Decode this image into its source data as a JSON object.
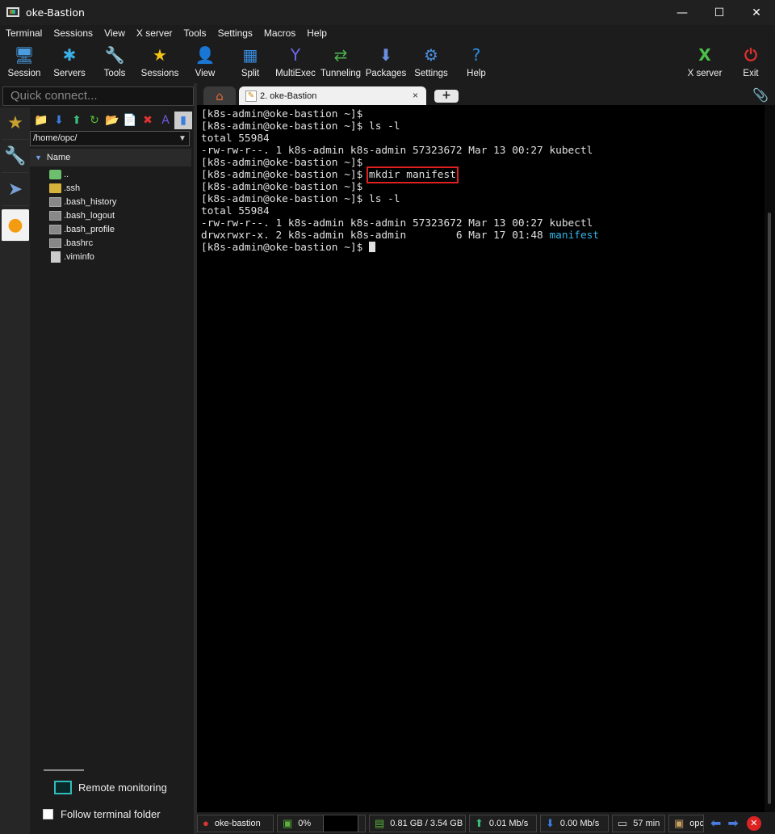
{
  "window": {
    "title": "oke-Bastion",
    "controls": {
      "minimize": "—",
      "maximize": "☐",
      "close": "✕"
    }
  },
  "menu": [
    "Terminal",
    "Sessions",
    "View",
    "X server",
    "Tools",
    "Settings",
    "Macros",
    "Help"
  ],
  "toolbar": {
    "buttons": [
      {
        "label": "Session",
        "icon": "session-icon",
        "glyph": "🖥",
        "color": "#4a9de0"
      },
      {
        "label": "Servers",
        "icon": "servers-icon",
        "glyph": "✱",
        "color": "#3ab0e8"
      },
      {
        "label": "Tools",
        "icon": "tools-icon",
        "glyph": "🔧",
        "color": "#d44"
      },
      {
        "label": "Sessions",
        "icon": "star-icon",
        "glyph": "★",
        "color": "#f2c318"
      },
      {
        "label": "View",
        "icon": "view-icon",
        "glyph": "👤",
        "color": "#5aa55a"
      },
      {
        "label": "Split",
        "icon": "split-icon",
        "glyph": "▦",
        "color": "#3a8de0"
      },
      {
        "label": "MultiExec",
        "icon": "multiexec-icon",
        "glyph": "Y",
        "color": "#6a6ae8"
      },
      {
        "label": "Tunneling",
        "icon": "tunneling-icon",
        "glyph": "⇄",
        "color": "#4ab04a"
      },
      {
        "label": "Packages",
        "icon": "packages-icon",
        "glyph": "⬇",
        "color": "#6a8ee0"
      },
      {
        "label": "Settings",
        "icon": "gear-icon",
        "glyph": "⚙",
        "color": "#4a8ee0"
      },
      {
        "label": "Help",
        "icon": "help-icon",
        "glyph": "?",
        "color": "#2a8ee8"
      }
    ],
    "right_buttons": [
      {
        "label": "X server",
        "icon": "x-server-icon",
        "glyph": "X",
        "color": "#4ac04a"
      },
      {
        "label": "Exit",
        "icon": "power-icon",
        "glyph": "⏻",
        "color": "#e03030"
      }
    ]
  },
  "quick_connect": {
    "placeholder": "Quick connect..."
  },
  "sftp": {
    "path": "/home/opc/",
    "column": "Name",
    "files": [
      {
        "name": "..",
        "type": "up"
      },
      {
        "name": ".ssh",
        "type": "folder"
      },
      {
        "name": ".bash_history",
        "type": "file"
      },
      {
        "name": ".bash_logout",
        "type": "file"
      },
      {
        "name": ".bash_profile",
        "type": "file"
      },
      {
        "name": ".bashrc",
        "type": "file"
      },
      {
        "name": ".viminfo",
        "type": "doc"
      }
    ],
    "remote_monitoring": "Remote monitoring",
    "follow_terminal_folder": "Follow terminal folder"
  },
  "tabs": {
    "active_tab": "2. oke-Bastion",
    "close": "×",
    "new": "+"
  },
  "terminal": {
    "lines": [
      {
        "text": "[k8s-admin@oke-bastion ~]$"
      },
      {
        "text": "[k8s-admin@oke-bastion ~]$ ls -l"
      },
      {
        "text": "total 55984"
      },
      {
        "text": "-rw-rw-r--. 1 k8s-admin k8s-admin 57323672 Mar 13 00:27 kubectl"
      },
      {
        "text": "[k8s-admin@oke-bastion ~]$"
      },
      {
        "prompt": "[k8s-admin@oke-bastion ~]$ ",
        "highlight": "mkdir manifest"
      },
      {
        "text": "[k8s-admin@oke-bastion ~]$"
      },
      {
        "text": "[k8s-admin@oke-bastion ~]$ ls -l"
      },
      {
        "text": "total 55984"
      },
      {
        "text": "-rw-rw-r--. 1 k8s-admin k8s-admin 57323672 Mar 13 00:27 kubectl"
      },
      {
        "prefix": "drwxrwxr-x. 2 k8s-admin k8s-admin        6 Mar 17 01:48 ",
        "dir": "manifest"
      },
      {
        "prompt": "[k8s-admin@oke-bastion ~]$ ",
        "cursor": true
      }
    ]
  },
  "status": {
    "session": "oke-bastion",
    "cpu": "0%",
    "memory": "0.81 GB / 3.54 GB",
    "upload": "0.01 Mb/s",
    "download": "0.00 Mb/s",
    "uptime": "57 min",
    "user": "opc"
  }
}
